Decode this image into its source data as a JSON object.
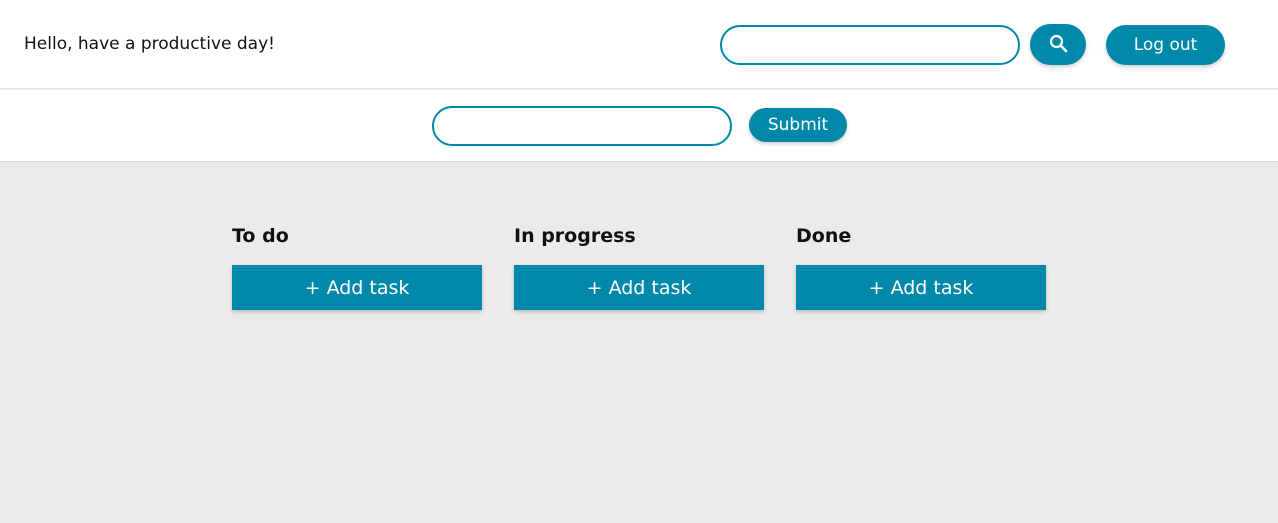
{
  "header": {
    "greeting": "Hello, have a productive day!",
    "search": {
      "value": "",
      "placeholder": ""
    },
    "search_icon": "search-icon",
    "logout_label": "Log out"
  },
  "task_form": {
    "input": {
      "value": "",
      "placeholder": ""
    },
    "submit_label": "Submit"
  },
  "board": {
    "columns": [
      {
        "title": "To do",
        "add_label": "+ Add task"
      },
      {
        "title": "In progress",
        "add_label": "+ Add task"
      },
      {
        "title": "Done",
        "add_label": "+ Add task"
      }
    ]
  },
  "colors": {
    "accent": "#0088a9",
    "board_background": "#ebebeb",
    "header_background": "#ffffff"
  }
}
